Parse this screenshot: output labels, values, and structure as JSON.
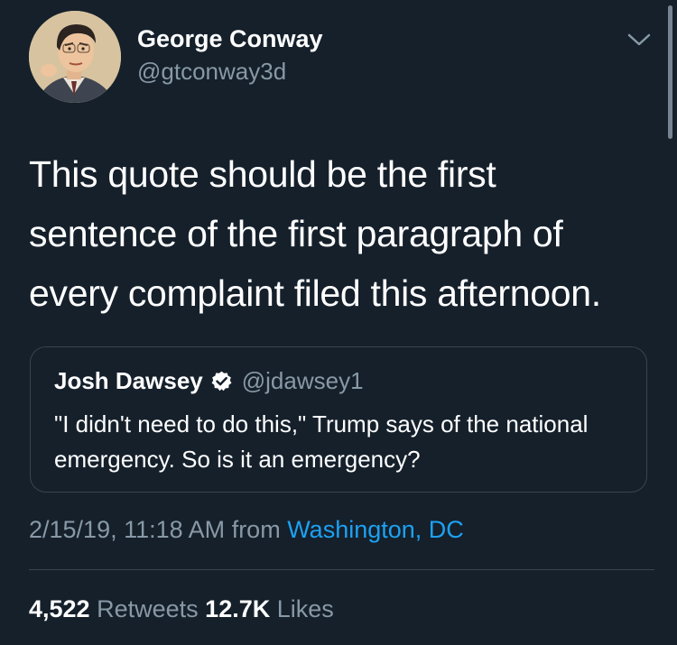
{
  "author": {
    "name": "George Conway",
    "handle": "@gtconway3d"
  },
  "tweet": {
    "text": "This quote should be the first sentence of the first paragraph of every complaint filed this afternoon."
  },
  "quoted_tweet": {
    "name": "Josh Dawsey",
    "handle": "@jdawsey1",
    "verified": true,
    "text": "\"I didn't need to do this,\" Trump says of the national emergency. So is it an emergency?"
  },
  "meta": {
    "timestamp": "2/15/19, 11:18 AM",
    "from_label": "from",
    "location": "Washington, DC"
  },
  "stats": {
    "retweets_count": "4,522",
    "retweets_label": "Retweets",
    "likes_count": "12.7K",
    "likes_label": "Likes"
  },
  "colors": {
    "background": "#15202b",
    "secondary_text": "#8899a6",
    "link": "#1da1f2",
    "border": "#38444d"
  },
  "icons": {
    "menu": "chevron-down-icon",
    "verified": "verified-badge-icon"
  }
}
